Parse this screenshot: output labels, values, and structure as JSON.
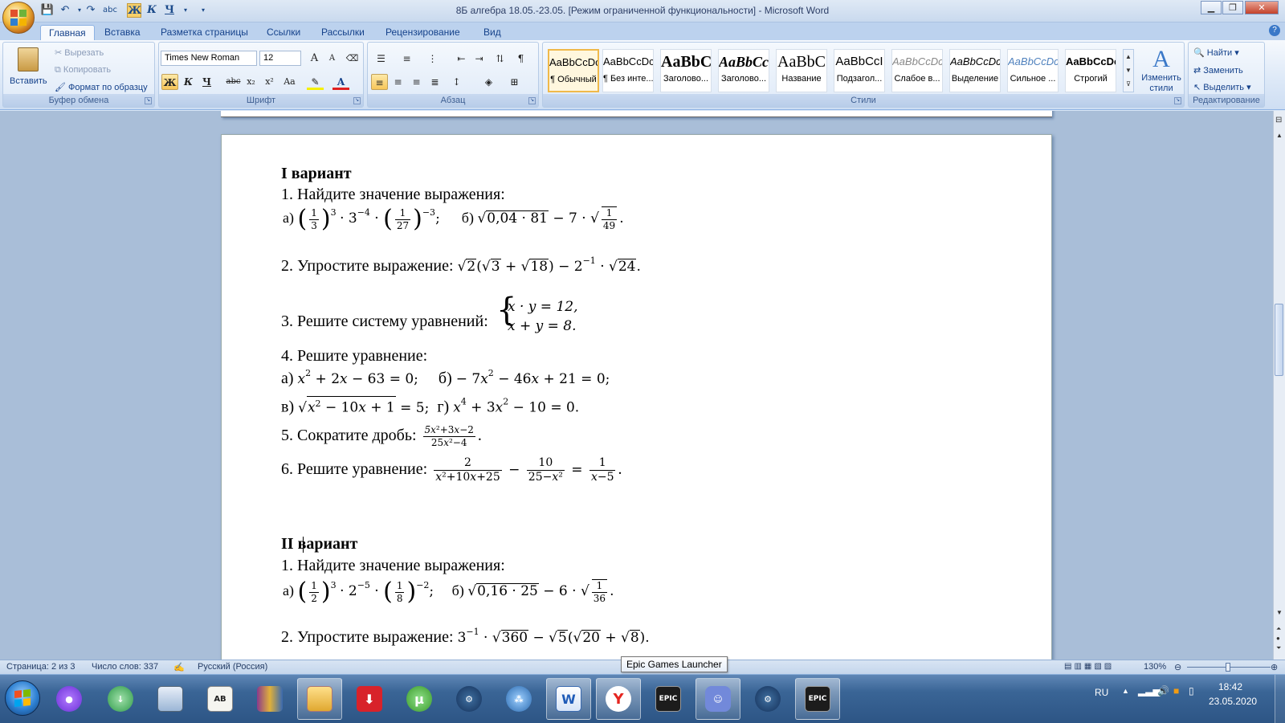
{
  "window": {
    "title": "8Б алгебра 18.05.-23.05. [Режим ограниченной функциональности] - Microsoft Word"
  },
  "quick_access": {
    "save": "💾",
    "undo": "↶",
    "redo": "↷",
    "spell": "abc",
    "bold": "Ж",
    "italic": "К",
    "underline": "Ч",
    "more": "▾"
  },
  "tabs": [
    "Главная",
    "Вставка",
    "Разметка страницы",
    "Ссылки",
    "Рассылки",
    "Рецензирование",
    "Вид"
  ],
  "clipboard": {
    "paste": "Вставить",
    "cut": "Вырезать",
    "copy": "Копировать",
    "format_painter": "Формат по образцу",
    "label": "Буфер обмена"
  },
  "font": {
    "name": "Times New Roman",
    "size": "12",
    "label": "Шрифт",
    "bold": "Ж",
    "italic": "К",
    "underline": "Ч",
    "strike": "abc",
    "sub": "x₂",
    "sup": "x²",
    "case": "Aa",
    "grow": "A",
    "shrink": "A"
  },
  "paragraph": {
    "label": "Абзац"
  },
  "styles": {
    "label": "Стили",
    "change": "Изменить стили",
    "items": [
      {
        "preview": "AaBbCcDc",
        "name": "¶ Обычный"
      },
      {
        "preview": "AaBbCcDc",
        "name": "¶ Без инте..."
      },
      {
        "preview": "AaBbC",
        "name": "Заголово..."
      },
      {
        "preview": "AaBbCc",
        "name": "Заголово..."
      },
      {
        "preview": "AaBbC",
        "name": "Название"
      },
      {
        "preview": "AaBbCcI",
        "name": "Подзагол..."
      },
      {
        "preview": "AaBbCcDc",
        "name": "Слабое в..."
      },
      {
        "preview": "AaBbCcDc",
        "name": "Выделение"
      },
      {
        "preview": "AaBbCcDc",
        "name": "Сильное ..."
      },
      {
        "preview": "AaBbCcDc",
        "name": "Строгий"
      }
    ]
  },
  "editing": {
    "find": "Найти",
    "replace": "Заменить",
    "select": "Выделить",
    "label": "Редактирование"
  },
  "document": {
    "v1_title": "I вариант",
    "v1_q1": "1. Найдите значение выражения:",
    "v1_q2": "2. Упростите выражение:",
    "v1_q3": "3. Решите систему уравнений:",
    "v1_q4": "4. Решите уравнение:",
    "v1_q5": "5. Сократите дробь:",
    "v1_q6": "6. Решите уравнение:",
    "v2_title": "II вариант",
    "v2_q1": "1. Найдите значение выражения:",
    "v2_q2": "2. Упростите выражение:"
  },
  "status": {
    "page": "Страница: 2 из 3",
    "words": "Число слов: 337",
    "lang": "Русский (Россия)",
    "zoom": "130%"
  },
  "tooltip": "Epic Games Launcher",
  "tray": {
    "lang": "RU",
    "time": "18:42",
    "date": "23.05.2020"
  }
}
